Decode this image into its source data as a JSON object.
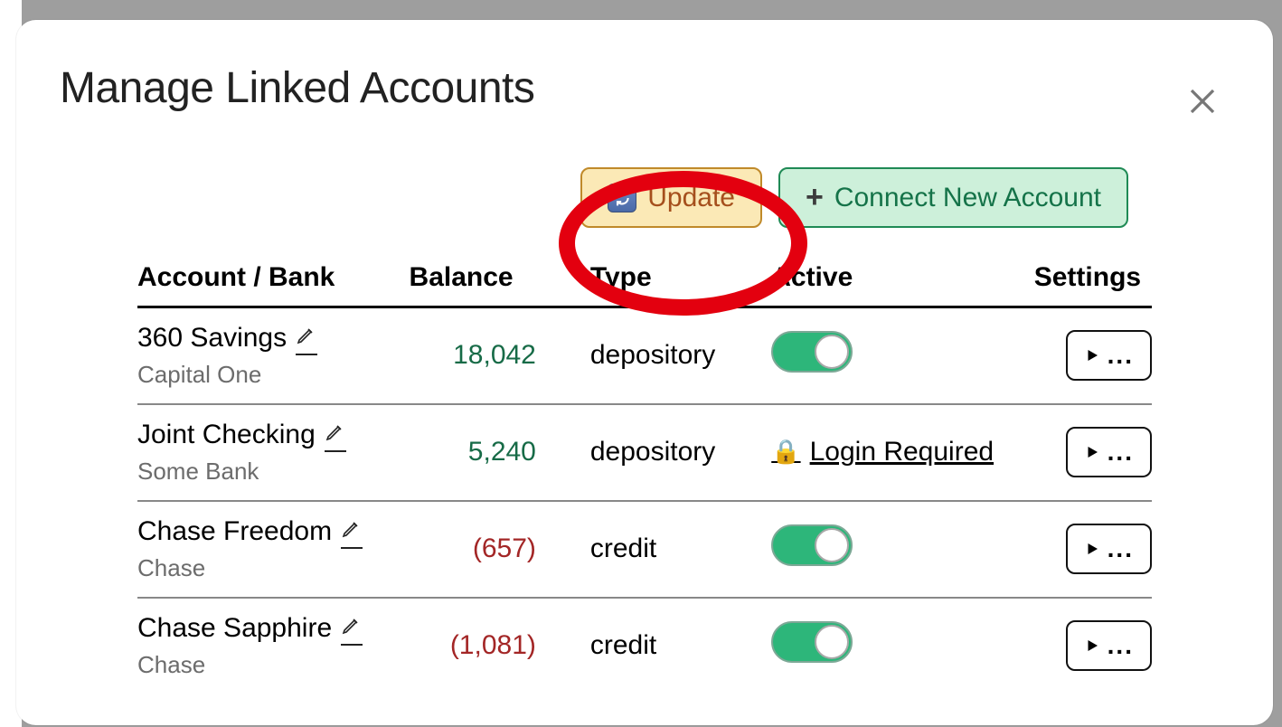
{
  "modal": {
    "title": "Manage Linked Accounts"
  },
  "toolbar": {
    "update_label": "Update",
    "connect_label": "Connect New Account"
  },
  "table": {
    "headers": {
      "account": "Account / Bank",
      "balance": "Balance",
      "type": "Type",
      "active": "Active",
      "settings": "Settings"
    },
    "rows": [
      {
        "name": "360 Savings",
        "bank": "Capital One",
        "balance": "18,042",
        "balance_negative": false,
        "type": "depository",
        "active_toggle": true,
        "login_required": false
      },
      {
        "name": "Joint Checking",
        "bank": "Some Bank",
        "balance": "5,240",
        "balance_negative": false,
        "type": "depository",
        "active_toggle": false,
        "login_required": true,
        "login_text": "Login Required"
      },
      {
        "name": "Chase Freedom",
        "bank": "Chase",
        "balance": "(657)",
        "balance_negative": true,
        "type": "credit",
        "active_toggle": true,
        "login_required": false
      },
      {
        "name": "Chase Sapphire",
        "bank": "Chase",
        "balance": "(1,081)",
        "balance_negative": true,
        "type": "credit",
        "active_toggle": true,
        "login_required": false
      }
    ],
    "settings_dots": "..."
  }
}
